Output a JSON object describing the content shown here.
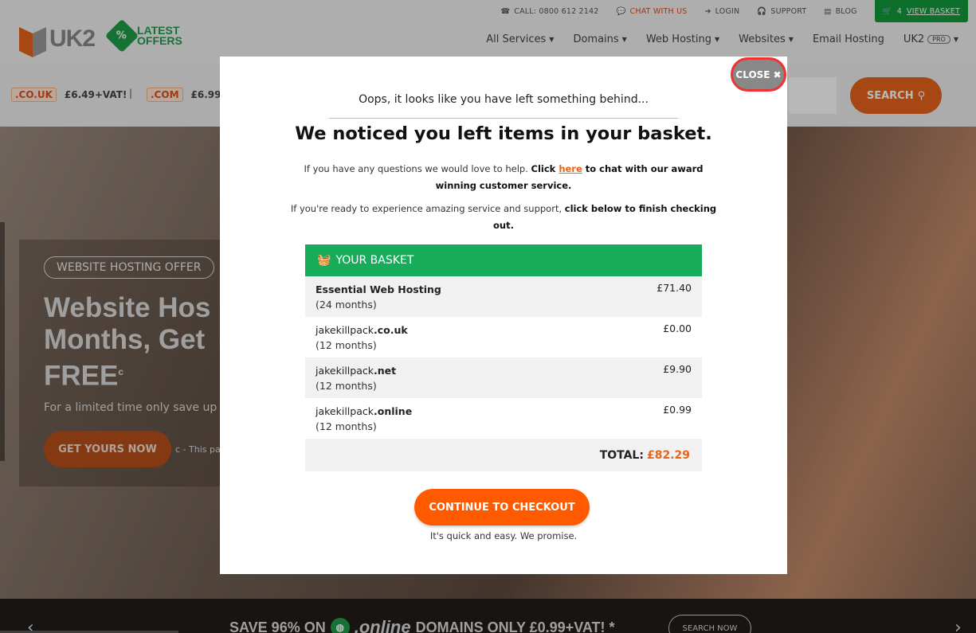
{
  "topbar": {
    "call": "CALL: 0800 612 2142",
    "chat": "CHAT WITH US",
    "login": "LOGIN",
    "support": "SUPPORT",
    "blog": "BLOG",
    "basket_count": "4",
    "view_basket": "VIEW BASKET"
  },
  "logo": {
    "brand": "UK2",
    "offers_line1": "LATEST",
    "offers_line2": "OFFERS",
    "offers_symbol": "%"
  },
  "nav": {
    "items": [
      {
        "label": "All Services"
      },
      {
        "label": "Domains"
      },
      {
        "label": "Web Hosting"
      },
      {
        "label": "Websites"
      },
      {
        "label": "Email Hosting"
      },
      {
        "label": "UK2"
      }
    ],
    "pro_badge": "PRO"
  },
  "domainbar": {
    "items": [
      {
        "ext": ".CO.UK",
        "price": "£6.49+VAT!"
      },
      {
        "ext": ".COM",
        "price": "£6.99+"
      }
    ],
    "separator": "|",
    "search_label": "SEARCH"
  },
  "hero": {
    "badge": "WEBSITE HOSTING OFFER",
    "title": "Website Hos\nMonths, Get\nFREE",
    "title_sup": "c",
    "subtitle": "For a limited time only save up",
    "cta": "GET YOURS NOW",
    "note": "c - This pa"
  },
  "promo": {
    "save_text": "SAVE 96% ON",
    "online": ".online",
    "rest": "DOMAINS ONLY £0.99+VAT! *",
    "search_now": "SEARCH NOW",
    "arrow_left": "‹",
    "arrow_right": "›"
  },
  "modal": {
    "close": "CLOSE",
    "oops": "Oops, it looks like you have left something behind...",
    "title": "We noticed you left items in your basket.",
    "p1_start": "If you have any questions we would love to help. ",
    "p1_click": "Click ",
    "p1_here": "here",
    "p1_end": " to chat with our award winning customer service.",
    "p2_start": "If you're ready to experience amazing service and support, ",
    "p2_bold": "click below to finish checking out.",
    "basket_title": "YOUR BASKET",
    "items": [
      {
        "name": "Essential Web Hosting",
        "name_bold": "",
        "term": "(24 months)",
        "price": "£71.40"
      },
      {
        "name": "jakekillpack",
        "name_bold": ".co.uk",
        "term": "(12 months)",
        "price": "£0.00"
      },
      {
        "name": "jakekillpack",
        "name_bold": ".net",
        "term": "(12 months)",
        "price": "£9.90"
      },
      {
        "name": "jakekillpack",
        "name_bold": ".online",
        "term": "(12 months)",
        "price": "£0.99"
      }
    ],
    "total_label": "TOTAL:",
    "total_amount": "£82.29",
    "checkout": "CONTINUE TO CHECKOUT",
    "quick": "It's quick and easy. We promise."
  },
  "colors": {
    "accent_orange": "#ff5a00",
    "basket_green": "#17ab5a",
    "close_border": "#ee3333"
  }
}
